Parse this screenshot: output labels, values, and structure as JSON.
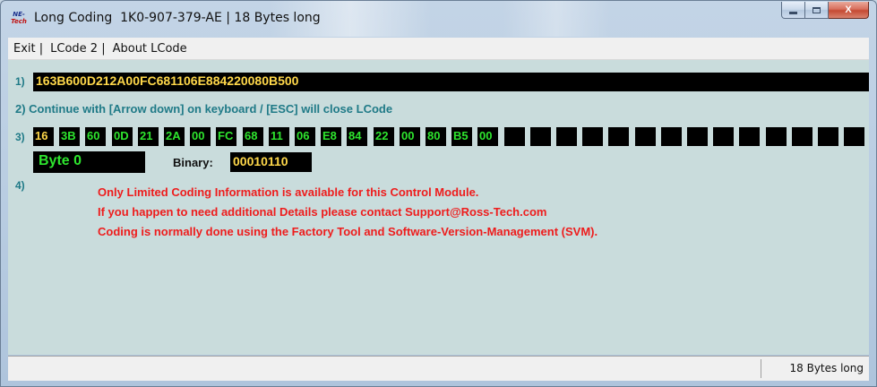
{
  "window": {
    "title": "Long Coding  1K0-907-379-AE | 18 Bytes long",
    "icon_text_top": "NE-",
    "icon_text_bottom": "Tech",
    "close_glyph": "X"
  },
  "menu": {
    "items": [
      "Exit |",
      "LCode 2 |",
      "About LCode"
    ]
  },
  "row1": {
    "number": "1)",
    "coding": "163B600D212A00FC681106E884220080B500"
  },
  "row2": {
    "text": "2) Continue with [Arrow down] on keyboard / [ESC] will close LCode"
  },
  "row3": {
    "number": "3)",
    "bytes": [
      "16",
      "3B",
      "60",
      "0D",
      "21",
      "2A",
      "00",
      "FC",
      "68",
      "11",
      "06",
      "E8",
      "84",
      "22",
      "00",
      "80",
      "B5",
      "00",
      "",
      "",
      "",
      "",
      "",
      "",
      "",
      "",
      "",
      "",
      "",
      "",
      "",
      ""
    ],
    "selected_index": 0
  },
  "byte_info": {
    "byte_label": "Byte 0",
    "binary_label": "Binary:",
    "binary_value": "00010110"
  },
  "row4": {
    "number": "4)",
    "messages": [
      "Only Limited Coding Information is available for this Control Module.",
      "If you happen to need additional Details please contact Support@Ross-Tech.com",
      "Coding is normally done using the Factory Tool and Software-Version-Management (SVM)."
    ]
  },
  "status": {
    "text": "18 Bytes long"
  },
  "colors": {
    "byte_text": "#2ee52e",
    "highlight_text": "#ffd84a",
    "message_text": "#ee1c1c",
    "row_label": "#1f7a87",
    "client_bg": "#c9dcdc"
  }
}
